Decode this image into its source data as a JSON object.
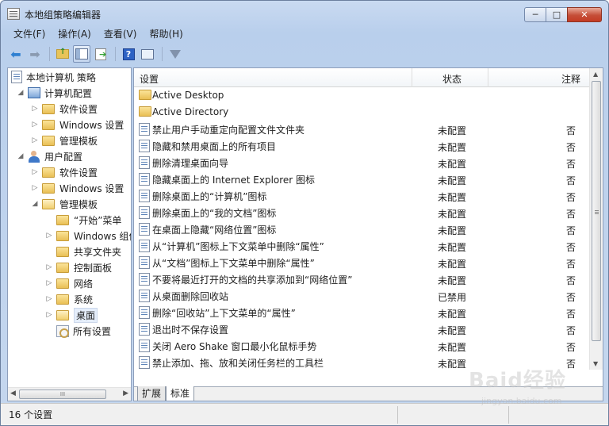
{
  "window": {
    "title": "本地组策略编辑器",
    "minimize_glyph": "─",
    "maximize_glyph": "□",
    "close_glyph": "✕"
  },
  "menu": [
    "文件(F)",
    "操作(A)",
    "查看(V)",
    "帮助(H)"
  ],
  "toolbar": {
    "icons": [
      "back-arrow-icon",
      "forward-arrow-icon",
      "up-folder-icon",
      "show-hide-tree-icon",
      "export-list-icon",
      "help-icon",
      "properties-icon",
      "filter-icon"
    ],
    "help_glyph": "?"
  },
  "tree": [
    {
      "label": "本地计算机 策略",
      "level": 0,
      "icon": "policy-doc-icon",
      "expander": ""
    },
    {
      "label": "计算机配置",
      "level": 1,
      "icon": "computer-icon",
      "expander": "◢"
    },
    {
      "label": "软件设置",
      "level": 2,
      "icon": "folder-icon",
      "expander": "▷"
    },
    {
      "label": "Windows 设置",
      "level": 2,
      "icon": "folder-icon",
      "expander": "▷"
    },
    {
      "label": "管理模板",
      "level": 2,
      "icon": "folder-icon",
      "expander": "▷"
    },
    {
      "label": "用户配置",
      "level": 1,
      "icon": "user-icon",
      "expander": "◢"
    },
    {
      "label": "软件设置",
      "level": 2,
      "icon": "folder-icon",
      "expander": "▷"
    },
    {
      "label": "Windows 设置",
      "level": 2,
      "icon": "folder-icon",
      "expander": "▷"
    },
    {
      "label": "管理模板",
      "level": 2,
      "icon": "folder-open-icon",
      "expander": "◢"
    },
    {
      "label": "“开始”菜单",
      "level": 3,
      "icon": "folder-icon",
      "expander": ""
    },
    {
      "label": "Windows 组件",
      "level": 3,
      "icon": "folder-icon",
      "expander": "▷"
    },
    {
      "label": "共享文件夹",
      "level": 3,
      "icon": "folder-icon",
      "expander": ""
    },
    {
      "label": "控制面板",
      "level": 3,
      "icon": "folder-icon",
      "expander": "▷"
    },
    {
      "label": "网络",
      "level": 3,
      "icon": "folder-icon",
      "expander": "▷"
    },
    {
      "label": "系统",
      "level": 3,
      "icon": "folder-icon",
      "expander": "▷"
    },
    {
      "label": "桌面",
      "level": 3,
      "icon": "folder-open-icon",
      "expander": "▷",
      "selected": true
    },
    {
      "label": "所有设置",
      "level": 3,
      "icon": "all-settings-icon",
      "expander": ""
    }
  ],
  "list": {
    "columns": [
      "设置",
      "状态",
      "注释"
    ],
    "rows": [
      {
        "type": "folder",
        "name": "Active Desktop",
        "state": "",
        "note": ""
      },
      {
        "type": "folder",
        "name": "Active Directory",
        "state": "",
        "note": ""
      },
      {
        "type": "policy",
        "name": "禁止用户手动重定向配置文件文件夹",
        "state": "未配置",
        "note": "否"
      },
      {
        "type": "policy",
        "name": "隐藏和禁用桌面上的所有项目",
        "state": "未配置",
        "note": "否"
      },
      {
        "type": "policy",
        "name": "删除清理桌面向导",
        "state": "未配置",
        "note": "否"
      },
      {
        "type": "policy",
        "name": "隐藏桌面上的 Internet Explorer 图标",
        "state": "未配置",
        "note": "否"
      },
      {
        "type": "policy",
        "name": "删除桌面上的“计算机”图标",
        "state": "未配置",
        "note": "否"
      },
      {
        "type": "policy",
        "name": "删除桌面上的“我的文档”图标",
        "state": "未配置",
        "note": "否"
      },
      {
        "type": "policy",
        "name": "在桌面上隐藏“网络位置”图标",
        "state": "未配置",
        "note": "否"
      },
      {
        "type": "policy",
        "name": "从“计算机”图标上下文菜单中删除“属性”",
        "state": "未配置",
        "note": "否"
      },
      {
        "type": "policy",
        "name": "从“文档”图标上下文菜单中删除“属性”",
        "state": "未配置",
        "note": "否"
      },
      {
        "type": "policy",
        "name": "不要将最近打开的文档的共享添加到“网络位置”",
        "state": "未配置",
        "note": "否"
      },
      {
        "type": "policy",
        "name": "从桌面删除回收站",
        "state": "已禁用",
        "note": "否"
      },
      {
        "type": "policy",
        "name": "删除“回收站”上下文菜单的“属性”",
        "state": "未配置",
        "note": "否"
      },
      {
        "type": "policy",
        "name": "退出时不保存设置",
        "state": "未配置",
        "note": "否"
      },
      {
        "type": "policy",
        "name": "关闭 Aero Shake 窗口最小化鼠标手势",
        "state": "未配置",
        "note": "否"
      },
      {
        "type": "policy",
        "name": "禁止添加、拖、放和关闭任务栏的工具栏",
        "state": "未配置",
        "note": "否"
      }
    ]
  },
  "tabs": [
    "扩展",
    "标准"
  ],
  "active_tab": "标准",
  "scroll": {
    "left_glyph": "◀",
    "right_glyph": "▶",
    "up_glyph": "▲",
    "down_glyph": "▼",
    "grip": "III"
  },
  "status": {
    "text": "16 个设置"
  },
  "watermark": {
    "brand": "Baid",
    "brand_suffix": "经验",
    "url": "jingyan.baidu.com"
  }
}
